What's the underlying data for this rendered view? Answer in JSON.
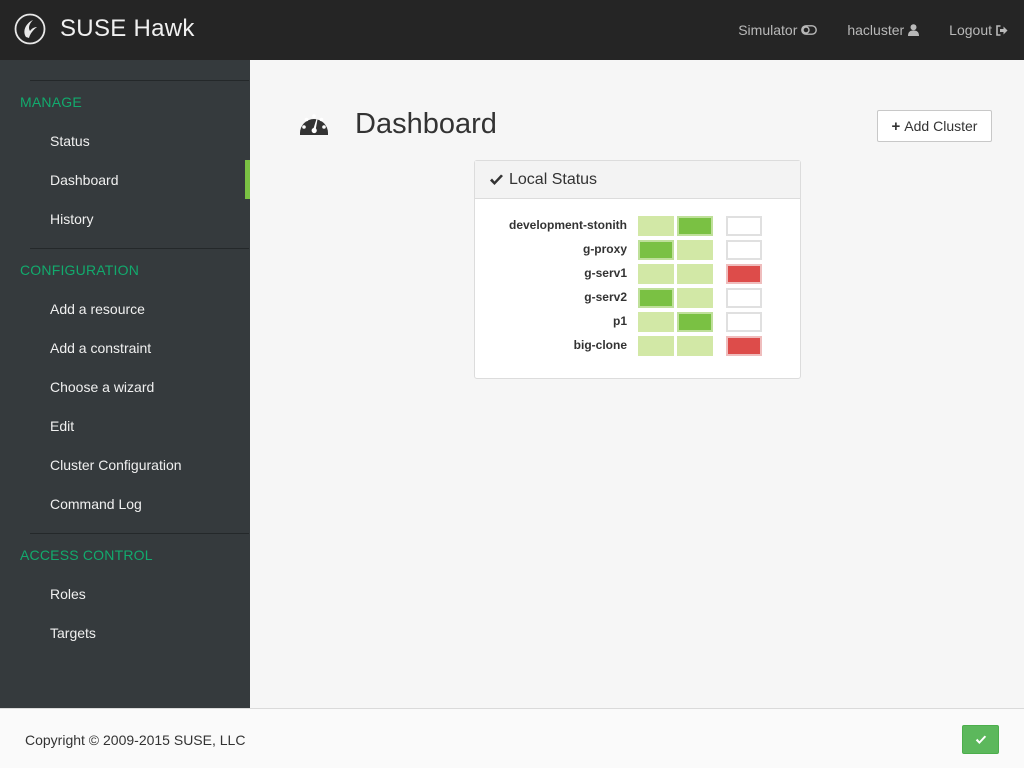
{
  "header": {
    "brand": "SUSE Hawk",
    "nav": [
      {
        "label": "Simulator",
        "icon": "toggle-icon"
      },
      {
        "label": "hacluster",
        "icon": "user-icon"
      },
      {
        "label": "Logout",
        "icon": "sign-out-icon"
      }
    ]
  },
  "sidebar": {
    "sections": [
      {
        "title": "MANAGE",
        "items": [
          "Status",
          "Dashboard",
          "History"
        ]
      },
      {
        "title": "CONFIGURATION",
        "items": [
          "Add a resource",
          "Add a constraint",
          "Choose a wizard",
          "Edit",
          "Cluster Configuration",
          "Command Log"
        ]
      },
      {
        "title": "ACCESS CONTROL",
        "items": [
          "Roles",
          "Targets"
        ]
      }
    ],
    "active_item": "Dashboard"
  },
  "main": {
    "title": "Dashboard",
    "add_cluster_label": "Add Cluster",
    "panel": {
      "title": "Local Status",
      "rows": [
        {
          "label": "development-stonith",
          "states": [
            "light",
            "green",
            "empty"
          ]
        },
        {
          "label": "g-proxy",
          "states": [
            "green",
            "light",
            "empty"
          ]
        },
        {
          "label": "g-serv1",
          "states": [
            "light",
            "light",
            "red"
          ]
        },
        {
          "label": "g-serv2",
          "states": [
            "green",
            "light",
            "empty"
          ]
        },
        {
          "label": "p1",
          "states": [
            "light",
            "green",
            "empty"
          ]
        },
        {
          "label": "big-clone",
          "states": [
            "light",
            "light",
            "red"
          ]
        }
      ]
    }
  },
  "footer": {
    "copyright": "Copyright © 2009-2015 SUSE, LLC"
  },
  "colors": {
    "topbar": "#252525",
    "sidebar": "#353a3d",
    "section_accent": "#12aa6d",
    "active_bar": "#7ac143",
    "state_light": "#d2e8a6",
    "state_green": "#7ac143",
    "state_red": "#dd4c4a"
  }
}
